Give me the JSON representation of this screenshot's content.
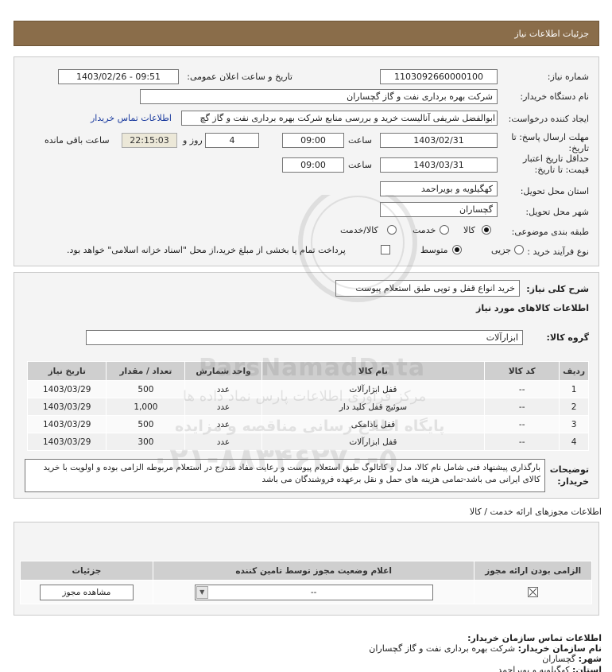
{
  "header": {
    "title": "جزئیات اطلاعات نیاز"
  },
  "form": {
    "need_number_label": "شماره نیاز:",
    "need_number": "1103092660000100",
    "announce_label": "تاریخ و ساعت اعلان عمومی:",
    "announce_value": "1403/02/26 - 09:51",
    "buyer_org_label": "نام دستگاه خریدار:",
    "buyer_org": "شرکت بهره برداری نفت و گاز گچساران",
    "creator_label": "ایجاد کننده درخواست:",
    "creator": "ابوالفضل شریفی آنالیست خرید و بررسی منابع شرکت بهره برداری نفت و گاز گچ",
    "contact_link": "اطلاعات تماس خریدار",
    "deadline_label": "مهلت ارسال پاسخ: تا تاریخ:",
    "deadline_date": "1403/02/31",
    "time_label": "ساعت",
    "deadline_time": "09:00",
    "days_value": "4",
    "days_label": "روز و",
    "remaining_time": "22:15:03",
    "remaining_label": "ساعت باقی مانده",
    "validity_label": "حداقل تاریخ اعتبار قیمت: تا تاریخ:",
    "validity_date": "1403/03/31",
    "validity_time": "09:00",
    "province_label": "استان محل تحویل:",
    "province": "کهگیلویه و بویراحمد",
    "city_label": "شهر محل تحویل:",
    "city": "گچساران",
    "category_label": "طبقه بندی موضوعی:",
    "category_options": [
      "کالا",
      "خدمت",
      "کالا/خدمت"
    ],
    "category_selected": "کالا",
    "purchase_label": "نوع فرآیند خرید :",
    "purchase_options": [
      "جزیی",
      "متوسط"
    ],
    "purchase_selected": "متوسط",
    "payment_note": "پرداخت تمام یا بخشی از مبلغ خرید،از محل \"اسناد خزانه اسلامی\" خواهد بود."
  },
  "summary": {
    "general_label": "شرح کلی نیاز:",
    "general_value": "خرید انواع قفل و توپی طبق استعلام پیوست",
    "goods_info_title": "اطلاعات کالاهای مورد نیاز",
    "group_label": "گروه کالا:",
    "group_value": "ابزارآلات",
    "table_headers": [
      "ردیف",
      "کد کالا",
      "نام کالا",
      "واحد شمارش",
      "تعداد / مقدار",
      "تاریخ نیاز"
    ],
    "rows": [
      {
        "row": "1",
        "code": "--",
        "name": "قفل ابزارآلات",
        "unit": "عدد",
        "qty": "500",
        "date": "1403/03/29"
      },
      {
        "row": "2",
        "code": "--",
        "name": "سوئیچ قفل کلید دار",
        "unit": "عدد",
        "qty": "1,000",
        "date": "1403/03/29"
      },
      {
        "row": "3",
        "code": "--",
        "name": "قفل بادامکی",
        "unit": "عدد",
        "qty": "500",
        "date": "1403/03/29"
      },
      {
        "row": "4",
        "code": "--",
        "name": "قفل ابزارآلات",
        "unit": "عدد",
        "qty": "300",
        "date": "1403/03/29"
      }
    ],
    "notes_label": "توضیحات خریدار:",
    "notes_value": "بارگذاری پیشنهاد فنی شامل نام کالا، مدل و کاتالوگ طبق استعلام پیوست و رعایت مفاد مندرج در استعلام مربوطه الزامی بوده و اولویت با خرید کالای ایرانی می باشد-تمامی هزینه های حمل و نقل برعهده فروشندگان می باشد"
  },
  "permits": {
    "section_title": "اطلاعات مجوزهای ارائه خدمت / کالا",
    "headers": [
      "الزامی بودن ارائه مجوز",
      "اعلام وضعیت مجوز توسط تامین کننده",
      "جزئیات"
    ],
    "status_value": "--",
    "view_button": "مشاهده مجوز"
  },
  "contact": {
    "title": "اطلاعات تماس سازمان خریدار:",
    "org_label": "نام سازمان خریدار:",
    "org_value": "شرکت بهره برداری نفت و گاز گچساران",
    "city_label": "شهر:",
    "city_value": "گچساران",
    "province_label": "استان:",
    "province_value": "کهگیلویه و بویراحمد"
  },
  "watermark": {
    "brand": "ParsNamadData",
    "line1": "مرکز فرآوری اطلاعات پارس نماد داده ها",
    "line2": "پایگاه اطلاع رسانی مناقصه و مزایده",
    "phone": "۰۲۱-۸۸۳۴۶۲۷۰-۵"
  }
}
